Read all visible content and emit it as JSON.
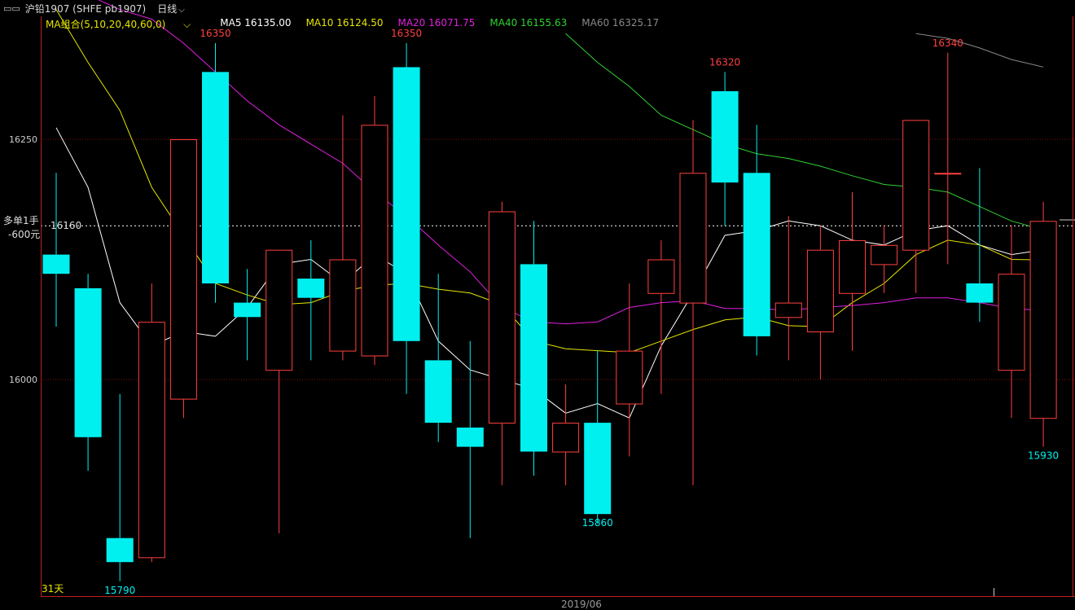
{
  "toolbar": {
    "instrument": "沪铅1907 (SHFE pb1907)",
    "period": "日线",
    "window_icon": "window-toggle-icon",
    "dropdown_icon": "chevron-down-icon"
  },
  "legend": {
    "selector": "MA组合(5,10,20,40,60,0)",
    "ma5": "MA5 16135.00",
    "ma10": "MA10 16124.50",
    "ma20": "MA20 16071.75",
    "ma40": "MA40 16155.63",
    "ma60": "MA60 16325.17"
  },
  "position": {
    "label1": "多单1手",
    "label2": "-600元",
    "price": "16160"
  },
  "footer": {
    "days": "31天",
    "date": "2019/06"
  },
  "colors": {
    "up": "#ff4040",
    "down": "#00f0f0",
    "ma5": "#ffffff",
    "ma10": "#e6e600",
    "ma20": "#e020e0",
    "ma40": "#30d030",
    "ma60": "#888888",
    "grid": "#7a1010",
    "axis": "#c02020"
  },
  "chart_data": {
    "type": "candlestick",
    "yticks": [
      16000,
      16250
    ],
    "position_price": 16160,
    "candles": [
      {
        "o": 16130,
        "h": 16215,
        "l": 16055,
        "c": 16110
      },
      {
        "o": 16095,
        "h": 16110,
        "l": 15905,
        "c": 15940
      },
      {
        "o": 15835,
        "h": 15985,
        "l": 15790,
        "c": 15810
      },
      {
        "o": 15815,
        "h": 16100,
        "l": 15810,
        "c": 16060
      },
      {
        "o": 15980,
        "h": 16120,
        "l": 15960,
        "c": 16250
      },
      {
        "o": 16320,
        "h": 16350,
        "l": 16080,
        "c": 16100
      },
      {
        "o": 16080,
        "h": 16115,
        "l": 16020,
        "c": 16065
      },
      {
        "o": 16010,
        "h": 16135,
        "l": 15840,
        "c": 16135
      },
      {
        "o": 16105,
        "h": 16145,
        "l": 16020,
        "c": 16085
      },
      {
        "o": 16030,
        "h": 16275,
        "l": 16020,
        "c": 16125
      },
      {
        "o": 16025,
        "h": 16295,
        "l": 16015,
        "c": 16265
      },
      {
        "o": 16325,
        "h": 16350,
        "l": 15985,
        "c": 16040
      },
      {
        "o": 16020,
        "h": 16110,
        "l": 15935,
        "c": 15955
      },
      {
        "o": 15950,
        "h": 16040,
        "l": 15835,
        "c": 15930
      },
      {
        "o": 15955,
        "h": 16185,
        "l": 15890,
        "c": 16175
      },
      {
        "o": 16120,
        "h": 16165,
        "l": 15900,
        "c": 15925
      },
      {
        "o": 15925,
        "h": 15995,
        "l": 15890,
        "c": 15955
      },
      {
        "o": 15955,
        "h": 16030,
        "l": 15850,
        "c": 15860
      },
      {
        "o": 15975,
        "h": 16100,
        "l": 15920,
        "c": 16030
      },
      {
        "o": 16090,
        "h": 16145,
        "l": 15985,
        "c": 16125
      },
      {
        "o": 16080,
        "h": 16270,
        "l": 15890,
        "c": 16215
      },
      {
        "o": 16300,
        "h": 16320,
        "l": 16160,
        "c": 16205
      },
      {
        "o": 16215,
        "h": 16265,
        "l": 16025,
        "c": 16045
      },
      {
        "o": 16065,
        "h": 16170,
        "l": 16020,
        "c": 16080
      },
      {
        "o": 16050,
        "h": 16160,
        "l": 16000,
        "c": 16135
      },
      {
        "o": 16090,
        "h": 16195,
        "l": 16030,
        "c": 16145
      },
      {
        "o": 16120,
        "h": 16160,
        "l": 16090,
        "c": 16140
      },
      {
        "o": 16135,
        "h": 16260,
        "l": 16090,
        "c": 16270
      },
      {
        "o": 16215,
        "h": 16340,
        "l": 16120,
        "c": 16215
      },
      {
        "o": 16100,
        "h": 16220,
        "l": 16060,
        "c": 16080
      },
      {
        "o": 16010,
        "h": 16160,
        "l": 15960,
        "c": 16110
      },
      {
        "o": 15960,
        "h": 16185,
        "l": 15930,
        "c": 16165
      }
    ],
    "ma5": [
      16262,
      16200,
      16080,
      16035,
      16050,
      16045,
      16075,
      16120,
      16125,
      16100,
      16130,
      16110,
      16040,
      16010,
      16000,
      15990,
      15965,
      15975,
      15960,
      16035,
      16090,
      16150,
      16155,
      16165,
      16160,
      16145,
      16140,
      16155,
      16160,
      16140,
      16130,
      16135
    ],
    "ma10": [
      16385,
      16330,
      16280,
      16200,
      16150,
      16100,
      16088,
      16078,
      16080,
      16092,
      16098,
      16100,
      16094,
      16090,
      16078,
      16040,
      16032,
      16030,
      16028,
      16040,
      16052,
      16062,
      16065,
      16056,
      16055,
      16080,
      16100,
      16130,
      16145,
      16140,
      16125,
      16124.5
    ],
    "ma20": [
      16400,
      16385,
      16375,
      16350,
      16320,
      16290,
      16265,
      16245,
      16225,
      16195,
      16170,
      16140,
      16112,
      16075,
      16060,
      16058,
      16060,
      16075,
      16080,
      16082,
      16074,
      16074,
      16072,
      16075,
      16077,
      16080,
      16085,
      16085,
      16080,
      16074,
      16071.75
    ],
    "ma40": [
      16360,
      16330,
      16305,
      16275,
      16260,
      16245,
      16235,
      16230,
      16222,
      16212,
      16203,
      16200,
      16195,
      16180,
      16165,
      16155.63
    ],
    "ma60": [
      16360,
      16355,
      16345,
      16333,
      16325.17
    ],
    "labels": [
      {
        "text": "16350",
        "idx": 5,
        "price": 16350,
        "pos": "above",
        "color": "up"
      },
      {
        "text": "16350",
        "idx": 11,
        "price": 16350,
        "pos": "above",
        "color": "up"
      },
      {
        "text": "16320",
        "idx": 21,
        "price": 16320,
        "pos": "above",
        "color": "up"
      },
      {
        "text": "16340",
        "idx": 28,
        "price": 16340,
        "pos": "above",
        "color": "up"
      },
      {
        "text": "15790",
        "idx": 2,
        "price": 15790,
        "pos": "below",
        "color": "down"
      },
      {
        "text": "15860",
        "idx": 17,
        "price": 15860,
        "pos": "below",
        "color": "down"
      },
      {
        "text": "15930",
        "idx": 31,
        "price": 15930,
        "pos": "below",
        "color": "down"
      }
    ]
  }
}
